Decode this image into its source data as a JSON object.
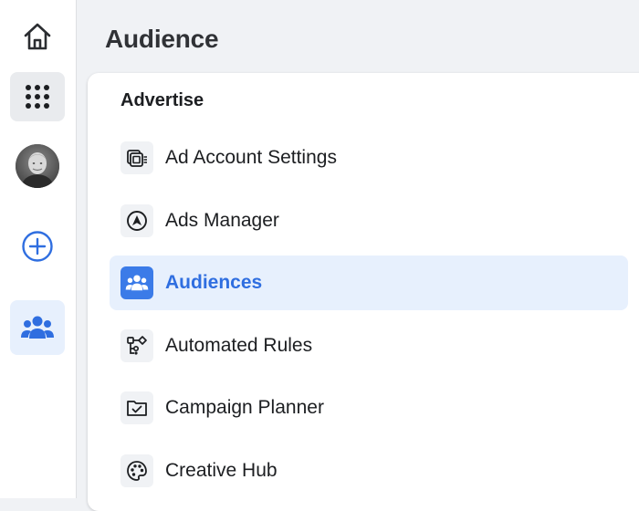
{
  "header": {
    "page_title": "Audience"
  },
  "sidebar": {
    "items": [
      {
        "icon": "home-icon"
      },
      {
        "icon": "grid-menu-icon"
      },
      {
        "icon": "avatar"
      },
      {
        "icon": "plus-circle-icon"
      },
      {
        "icon": "people-icon",
        "active": true
      }
    ]
  },
  "menu": {
    "section_title": "Advertise",
    "items": [
      {
        "label": "Ad Account Settings",
        "icon": "ad-account-settings-icon"
      },
      {
        "label": "Ads Manager",
        "icon": "navigation-arrow-icon"
      },
      {
        "label": "Audiences",
        "icon": "people-icon",
        "active": true
      },
      {
        "label": "Automated Rules",
        "icon": "automation-icon"
      },
      {
        "label": "Campaign Planner",
        "icon": "folder-check-icon"
      },
      {
        "label": "Creative Hub",
        "icon": "palette-icon"
      }
    ]
  },
  "colors": {
    "accent": "#3b7be8",
    "accent_text": "#2f6ee0",
    "active_bg": "#e7f0fd",
    "page_bg": "#f0f2f5"
  }
}
